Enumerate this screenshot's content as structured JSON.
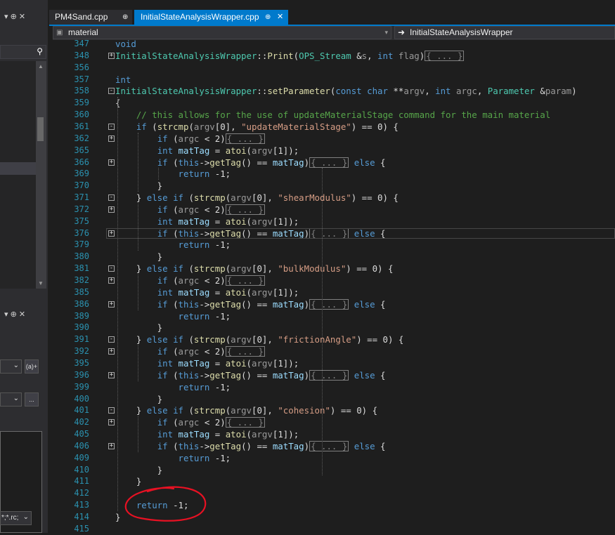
{
  "tabs": [
    {
      "label": "PM4Sand.cpp",
      "pin": "⊕",
      "active": false
    },
    {
      "label": "InitialStateAnalysisWrapper.cpp",
      "pin": "⊕",
      "close": "✕",
      "active": true
    }
  ],
  "navbar": {
    "left_scope": "material",
    "right_scope": "InitialStateAnalysisWrapper"
  },
  "left_panel": {
    "top_controls": "▾ ⊕ ✕",
    "lower_controls": "▾ ⊕ ✕",
    "button_a": "(a)+",
    "button_dots": "...",
    "filter_text": "*;*.rc;"
  },
  "colors": {
    "accent": "#007acc",
    "background": "#1e1e1e",
    "annotation": "#e81123"
  },
  "code_lines": [
    {
      "num": "347",
      "html": "<span class='kw'>void</span>"
    },
    {
      "num": "348",
      "html": "<span class='ty'>InitialStateAnalysisWrapper</span>::<span class='fn'>Print</span>(<span class='ty'>OPS_Stream</span> &amp;<span class='pr'>s</span>, <span class='kw'>int</span> <span class='pr'>flag</span>)<span class='col'>{ ... }</span>"
    },
    {
      "num": "356",
      "html": ""
    },
    {
      "num": "357",
      "html": "<span class='kw'>int</span>"
    },
    {
      "num": "358",
      "html": "<span class='ty'>InitialStateAnalysisWrapper</span>::<span class='fn'>setParameter</span>(<span class='kw'>const</span> <span class='kw'>char</span> **<span class='pr'>argv</span>, <span class='kw'>int</span> <span class='pr'>argc</span>, <span class='ty'>Parameter</span> &amp;<span class='pr'>param</span>)"
    },
    {
      "num": "359",
      "html": "{"
    },
    {
      "num": "360",
      "html": "    <span class='cm'>// this allows for the use of updateMaterialStage command for the main material</span>"
    },
    {
      "num": "361",
      "html": "    <span class='kw'>if</span> (<span class='fn'>strcmp</span>(<span class='pr'>argv</span>[0], <span class='st'>\"updateMaterialStage\"</span>) == 0) {"
    },
    {
      "num": "362",
      "html": "        <span class='kw'>if</span> (<span class='pr'>argc</span> &lt; 2)<span class='col'>{ ... }</span>"
    },
    {
      "num": "365",
      "html": "        <span class='kw'>int</span> <span class='lv'>matTag</span> = <span class='fn'>atoi</span>(<span class='pr'>argv</span>[1]);"
    },
    {
      "num": "366",
      "html": "        <span class='kw'>if</span> (<span class='kw'>this</span>-&gt;<span class='fn'>getTag</span>() == <span class='lv'>matTag</span>)<span class='col'>{ ... }</span> <span class='kw'>else</span> {"
    },
    {
      "num": "369",
      "html": "            <span class='kw'>return</span> -1;"
    },
    {
      "num": "370",
      "html": "        }"
    },
    {
      "num": "371",
      "html": "    } <span class='kw'>else</span> <span class='kw'>if</span> (<span class='fn'>strcmp</span>(<span class='pr'>argv</span>[0], <span class='st'>\"shearModulus\"</span>) == 0) {"
    },
    {
      "num": "372",
      "html": "        <span class='kw'>if</span> (<span class='pr'>argc</span> &lt; 2)<span class='col'>{ ... }</span>"
    },
    {
      "num": "375",
      "html": "        <span class='kw'>int</span> <span class='lv'>matTag</span> = <span class='fn'>atoi</span>(<span class='pr'>argv</span>[1]);"
    },
    {
      "num": "376",
      "html": "        <span class='kw'>if</span> (<span class='kw'>this</span>-&gt;<span class='fn'>getTag</span>() == <span class='lv'>matTag</span>)<span class='col'>{ ... }</span> <span class='kw'>else</span> {"
    },
    {
      "num": "379",
      "html": "            <span class='kw'>return</span> -1;"
    },
    {
      "num": "380",
      "html": "        }"
    },
    {
      "num": "381",
      "html": "    } <span class='kw'>else</span> <span class='kw'>if</span> (<span class='fn'>strcmp</span>(<span class='pr'>argv</span>[0], <span class='st'>\"bulkModulus\"</span>) == 0) {"
    },
    {
      "num": "382",
      "html": "        <span class='kw'>if</span> (<span class='pr'>argc</span> &lt; 2)<span class='col'>{ ... }</span>"
    },
    {
      "num": "385",
      "html": "        <span class='kw'>int</span> <span class='lv'>matTag</span> = <span class='fn'>atoi</span>(<span class='pr'>argv</span>[1]);"
    },
    {
      "num": "386",
      "html": "        <span class='kw'>if</span> (<span class='kw'>this</span>-&gt;<span class='fn'>getTag</span>() == <span class='lv'>matTag</span>)<span class='col'>{ ... }</span> <span class='kw'>else</span> {"
    },
    {
      "num": "389",
      "html": "            <span class='kw'>return</span> -1;"
    },
    {
      "num": "390",
      "html": "        }"
    },
    {
      "num": "391",
      "html": "    } <span class='kw'>else</span> <span class='kw'>if</span> (<span class='fn'>strcmp</span>(<span class='pr'>argv</span>[0], <span class='st'>\"frictionAngle\"</span>) == 0) {"
    },
    {
      "num": "392",
      "html": "        <span class='kw'>if</span> (<span class='pr'>argc</span> &lt; 2)<span class='col'>{ ... }</span>"
    },
    {
      "num": "395",
      "html": "        <span class='kw'>int</span> <span class='lv'>matTag</span> = <span class='fn'>atoi</span>(<span class='pr'>argv</span>[1]);"
    },
    {
      "num": "396",
      "html": "        <span class='kw'>if</span> (<span class='kw'>this</span>-&gt;<span class='fn'>getTag</span>() == <span class='lv'>matTag</span>)<span class='col'>{ ... }</span> <span class='kw'>else</span> {"
    },
    {
      "num": "399",
      "html": "            <span class='kw'>return</span> -1;"
    },
    {
      "num": "400",
      "html": "        }"
    },
    {
      "num": "401",
      "html": "    } <span class='kw'>else</span> <span class='kw'>if</span> (<span class='fn'>strcmp</span>(<span class='pr'>argv</span>[0], <span class='st'>\"cohesion\"</span>) == 0) {"
    },
    {
      "num": "402",
      "html": "        <span class='kw'>if</span> (<span class='pr'>argc</span> &lt; 2)<span class='col'>{ ... }</span>"
    },
    {
      "num": "405",
      "html": "        <span class='kw'>int</span> <span class='lv'>matTag</span> = <span class='fn'>atoi</span>(<span class='pr'>argv</span>[1]);"
    },
    {
      "num": "406",
      "html": "        <span class='kw'>if</span> (<span class='kw'>this</span>-&gt;<span class='fn'>getTag</span>() == <span class='lv'>matTag</span>)<span class='col'>{ ... }</span> <span class='kw'>else</span> {"
    },
    {
      "num": "409",
      "html": "            <span class='kw'>return</span> -1;"
    },
    {
      "num": "410",
      "html": "        }"
    },
    {
      "num": "411",
      "html": "    }"
    },
    {
      "num": "412",
      "html": ""
    },
    {
      "num": "413",
      "html": "    <span class='kw'>return</span> -1;"
    },
    {
      "num": "414",
      "html": "}"
    },
    {
      "num": "415",
      "html": ""
    }
  ]
}
